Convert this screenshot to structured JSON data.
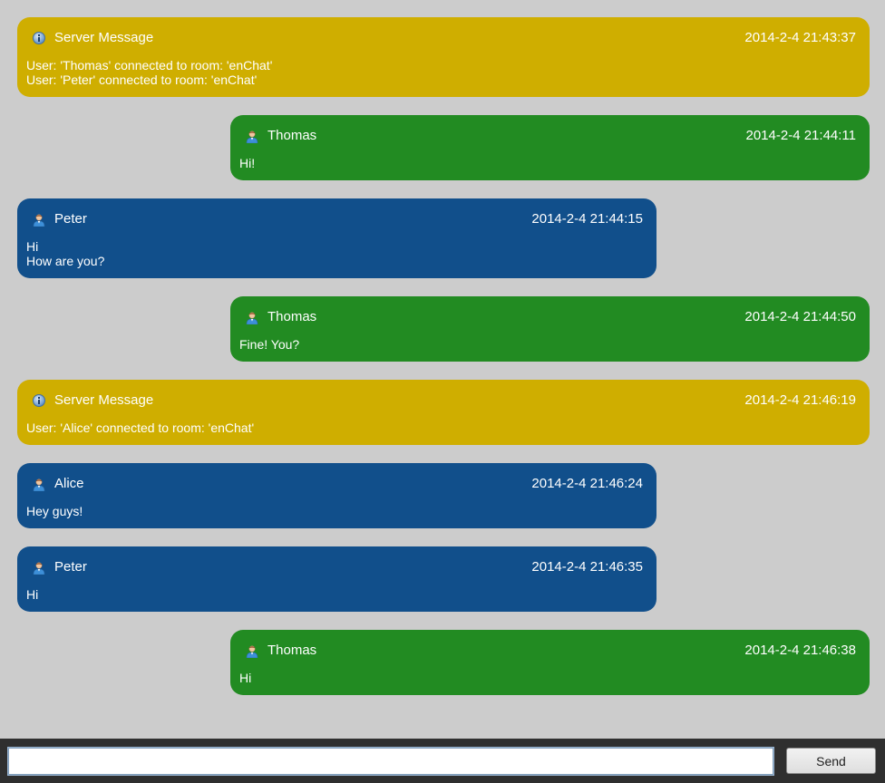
{
  "colors": {
    "background": "#cccccc",
    "server_bubble": "#cfae00",
    "own_bubble": "#228b22",
    "other_bubble": "#114f8b",
    "input_bar": "#2f2f2f"
  },
  "messages": [
    {
      "kind": "server",
      "icon": "info-icon",
      "sender": "Server Message",
      "time": "2014-2-4 21:43:37",
      "lines": [
        "User: 'Thomas' connected to room: 'enChat'",
        "User: 'Peter' connected to room: 'enChat'"
      ]
    },
    {
      "kind": "self",
      "icon": "user-icon",
      "sender": "Thomas",
      "time": "2014-2-4 21:44:11",
      "lines": [
        "Hi!"
      ]
    },
    {
      "kind": "other",
      "icon": "user-icon",
      "sender": "Peter",
      "time": "2014-2-4 21:44:15",
      "lines": [
        "Hi",
        "How are you?"
      ]
    },
    {
      "kind": "self",
      "icon": "user-icon",
      "sender": "Thomas",
      "time": "2014-2-4 21:44:50",
      "lines": [
        "Fine! You?"
      ]
    },
    {
      "kind": "server",
      "icon": "info-icon",
      "sender": "Server Message",
      "time": "2014-2-4 21:46:19",
      "lines": [
        "User: 'Alice' connected to room: 'enChat'"
      ]
    },
    {
      "kind": "other",
      "icon": "user-icon",
      "sender": "Alice",
      "time": "2014-2-4 21:46:24",
      "lines": [
        "Hey guys!"
      ]
    },
    {
      "kind": "other",
      "icon": "user-icon",
      "sender": "Peter",
      "time": "2014-2-4 21:46:35",
      "lines": [
        "Hi"
      ]
    },
    {
      "kind": "self",
      "icon": "user-icon",
      "sender": "Thomas",
      "time": "2014-2-4 21:46:38",
      "lines": [
        "Hi"
      ]
    }
  ],
  "input": {
    "value": "",
    "placeholder": ""
  },
  "send_label": "Send"
}
